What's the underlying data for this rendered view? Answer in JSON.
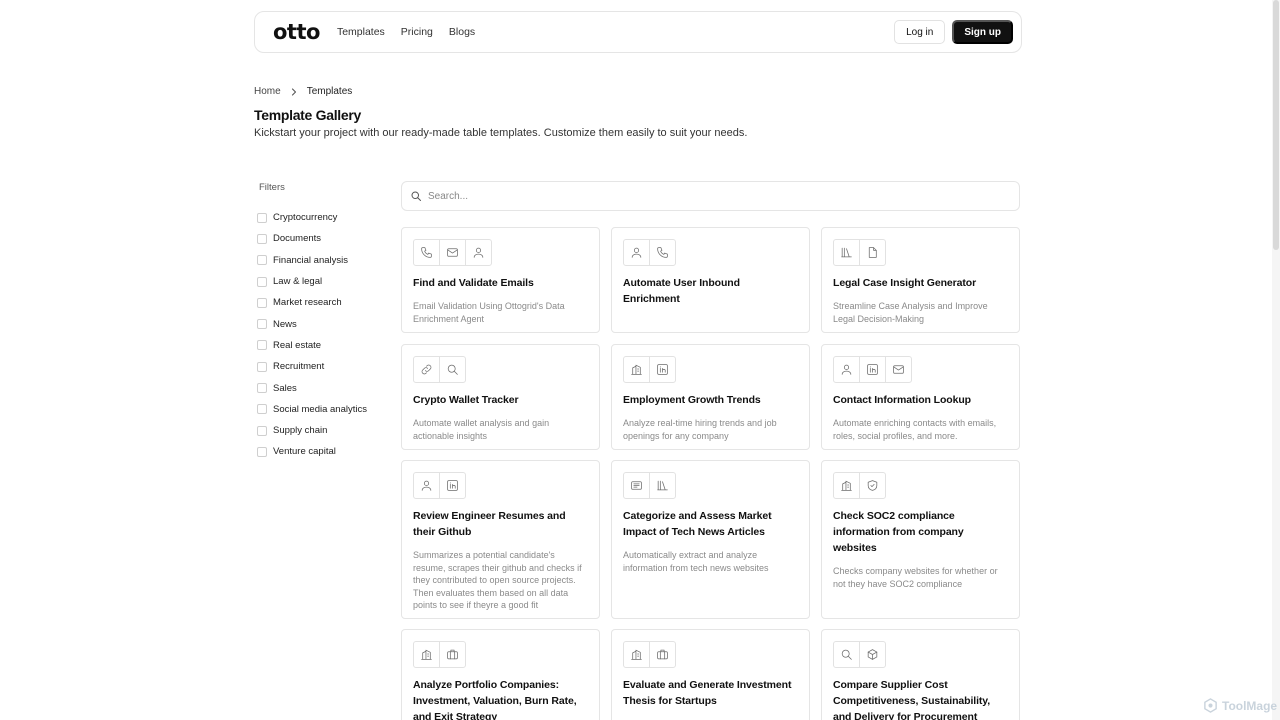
{
  "nav": {
    "logo": "otto",
    "links": [
      "Templates",
      "Pricing",
      "Blogs"
    ],
    "login_label": "Log in",
    "signup_label": "Sign up"
  },
  "breadcrumb": {
    "home": "Home",
    "current": "Templates"
  },
  "header": {
    "title": "Template Gallery",
    "subtitle": "Kickstart your project with our ready-made table templates. Customize them easily to suit your needs."
  },
  "filters": {
    "label": "Filters",
    "items": [
      "Cryptocurrency",
      "Documents",
      "Financial analysis",
      "Law & legal",
      "Market research",
      "News",
      "Real estate",
      "Recruitment",
      "Sales",
      "Social media analytics",
      "Supply chain",
      "Venture capital"
    ]
  },
  "search": {
    "placeholder": "Search..."
  },
  "cards": [
    {
      "title": "Find and Validate Emails",
      "description": "Email Validation Using Ottogrid's Data Enrichment Agent",
      "icons": [
        "phone-icon",
        "mail-icon",
        "user-icon"
      ]
    },
    {
      "title": "Automate User Inbound Enrichment",
      "description": "",
      "icons": [
        "user-icon",
        "phone-icon"
      ]
    },
    {
      "title": "Legal Case Insight Generator",
      "description": "Streamline Case Analysis and Improve Legal Decision-Making",
      "icons": [
        "library-icon",
        "file-icon"
      ]
    },
    {
      "title": "Crypto Wallet Tracker",
      "description": "Automate wallet analysis and gain actionable insights",
      "icons": [
        "link-icon",
        "search-icon"
      ]
    },
    {
      "title": "Employment Growth Trends",
      "description": "Analyze real-time hiring trends and job openings for any company",
      "icons": [
        "building-icon",
        "linkedin-icon"
      ]
    },
    {
      "title": "Contact Information Lookup",
      "description": "Automate enriching contacts with emails, roles, social profiles, and more.",
      "icons": [
        "user-icon",
        "linkedin-icon",
        "mail-icon"
      ]
    },
    {
      "title": "Review Engineer Resumes and their Github",
      "description": "Summarizes a potential candidate's resume, scrapes their github and checks if they contributed to open source projects. Then evaluates them based on all data points to see if theyre a good fit",
      "icons": [
        "user-icon",
        "linkedin-icon"
      ]
    },
    {
      "title": "Categorize and Assess Market Impact of Tech News Articles",
      "description": "Automatically extract and analyze information from tech news websites",
      "icons": [
        "news-icon",
        "library-icon"
      ]
    },
    {
      "title": "Check SOC2 compliance information from company websites",
      "description": "Checks company websites for whether or not they have SOC2 compliance",
      "icons": [
        "building-icon",
        "shield-icon"
      ]
    },
    {
      "title": "Analyze Portfolio Companies: Investment, Valuation, Burn Rate, and Exit Strategy",
      "description": "",
      "icons": [
        "building-icon",
        "briefcase-icon"
      ]
    },
    {
      "title": "Evaluate and Generate Investment Thesis for Startups",
      "description": "",
      "icons": [
        "building-icon",
        "briefcase-icon"
      ]
    },
    {
      "title": "Compare Supplier Cost Competitiveness, Sustainability, and Delivery for Procurement",
      "description": "",
      "icons": [
        "search-icon",
        "package-icon"
      ]
    }
  ],
  "watermark": "ToolMage"
}
